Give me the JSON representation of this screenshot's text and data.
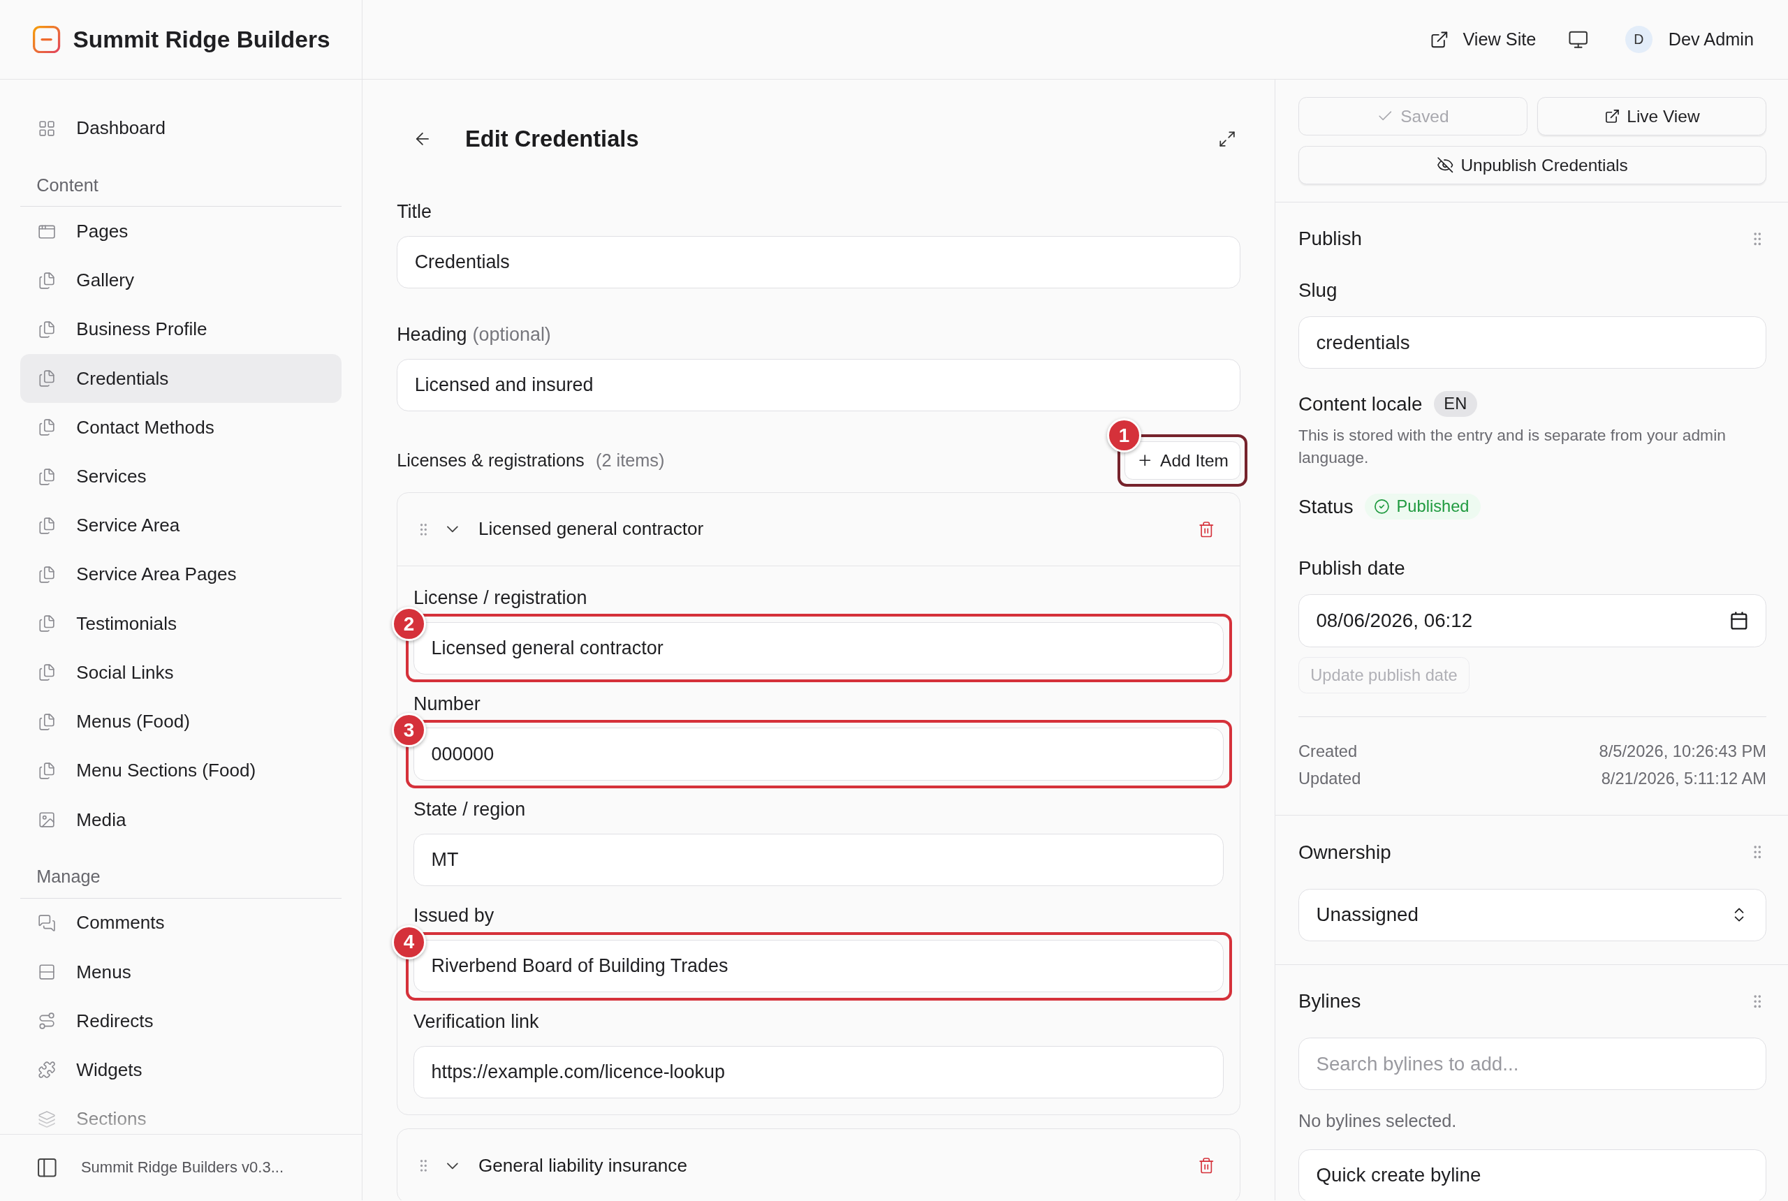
{
  "brand": {
    "name": "Summit Ridge Builders"
  },
  "topbar": {
    "view_site": "View Site",
    "user": {
      "initial": "D",
      "name": "Dev Admin"
    }
  },
  "sidebar": {
    "top": [
      {
        "label": "Dashboard",
        "kind": "grid",
        "selected": false
      }
    ],
    "groups": [
      {
        "heading": "Content",
        "items": [
          {
            "label": "Pages",
            "kind": "window",
            "selected": false
          },
          {
            "label": "Gallery",
            "kind": "document",
            "selected": false
          },
          {
            "label": "Business Profile",
            "kind": "document",
            "selected": false
          },
          {
            "label": "Credentials",
            "kind": "document",
            "selected": true
          },
          {
            "label": "Contact Methods",
            "kind": "document",
            "selected": false
          },
          {
            "label": "Services",
            "kind": "document",
            "selected": false
          },
          {
            "label": "Service Area",
            "kind": "document",
            "selected": false
          },
          {
            "label": "Service Area Pages",
            "kind": "document",
            "selected": false
          },
          {
            "label": "Testimonials",
            "kind": "document",
            "selected": false
          },
          {
            "label": "Social Links",
            "kind": "document",
            "selected": false
          },
          {
            "label": "Menus (Food)",
            "kind": "document",
            "selected": false
          },
          {
            "label": "Menu Sections (Food)",
            "kind": "document",
            "selected": false
          },
          {
            "label": "Media",
            "kind": "image",
            "selected": false
          }
        ]
      },
      {
        "heading": "Manage",
        "items": [
          {
            "label": "Comments",
            "kind": "chat",
            "selected": false
          },
          {
            "label": "Menus",
            "kind": "rows",
            "selected": false
          },
          {
            "label": "Redirects",
            "kind": "route",
            "selected": false
          },
          {
            "label": "Widgets",
            "kind": "puzzle",
            "selected": false
          },
          {
            "label": "Sections",
            "kind": "stack",
            "selected": false
          }
        ]
      }
    ],
    "footer": "Summit Ridge Builders v0.3..."
  },
  "editor": {
    "title": "Edit Credentials",
    "fields": [
      {
        "label": "Title",
        "value": "Credentials"
      },
      {
        "label": "Heading",
        "hint": "(optional)",
        "value": "Licensed and insured"
      }
    ],
    "repeater": {
      "label": "Licenses & registrations",
      "count": "(2 items)",
      "add_button": {
        "label": "Add Item",
        "callout": {
          "number": "1",
          "color": "#76232c"
        }
      },
      "items": [
        {
          "title": "Licensed general contractor",
          "fields": [
            {
              "label": "License / registration",
              "value": "Licensed general contractor",
              "callout": {
                "number": "2",
                "color": "#d5313a"
              }
            },
            {
              "label": "Number",
              "value": "000000",
              "callout": {
                "number": "3",
                "color": "#d5313a"
              }
            },
            {
              "label": "State / region",
              "value": "MT"
            },
            {
              "label": "Issued by",
              "value": "Riverbend Board of Building Trades",
              "callout": {
                "number": "4",
                "color": "#d5313a"
              }
            },
            {
              "label": "Verification link",
              "value": "https://example.com/licence-lookup"
            }
          ]
        },
        {
          "title": "General liability insurance"
        }
      ]
    }
  },
  "actions": {
    "saved": {
      "label": "Saved",
      "disabled": true
    },
    "live_view": "Live View",
    "unpublish": "Unpublish Credentials"
  },
  "publish": {
    "title": "Publish",
    "slug_label": "Slug",
    "slug": "credentials",
    "locale_label": "Content locale",
    "locale": "EN",
    "locale_note": "This is stored with the entry and is separate from your admin language.",
    "status_label": "Status",
    "status": "Published",
    "date_label": "Publish date",
    "date": "08/06/2026, 06:12",
    "update_button": {
      "label": "Update publish date",
      "disabled": true
    },
    "meta": [
      {
        "label": "Created",
        "value": "8/5/2026, 10:26:43 PM"
      },
      {
        "label": "Updated",
        "value": "8/21/2026, 5:11:12 AM"
      }
    ]
  },
  "ownership": {
    "title": "Ownership",
    "value": "Unassigned"
  },
  "bylines": {
    "title": "Bylines",
    "placeholder": "Search bylines to add...",
    "empty": "No bylines selected.",
    "create_button": "Quick create byline"
  }
}
